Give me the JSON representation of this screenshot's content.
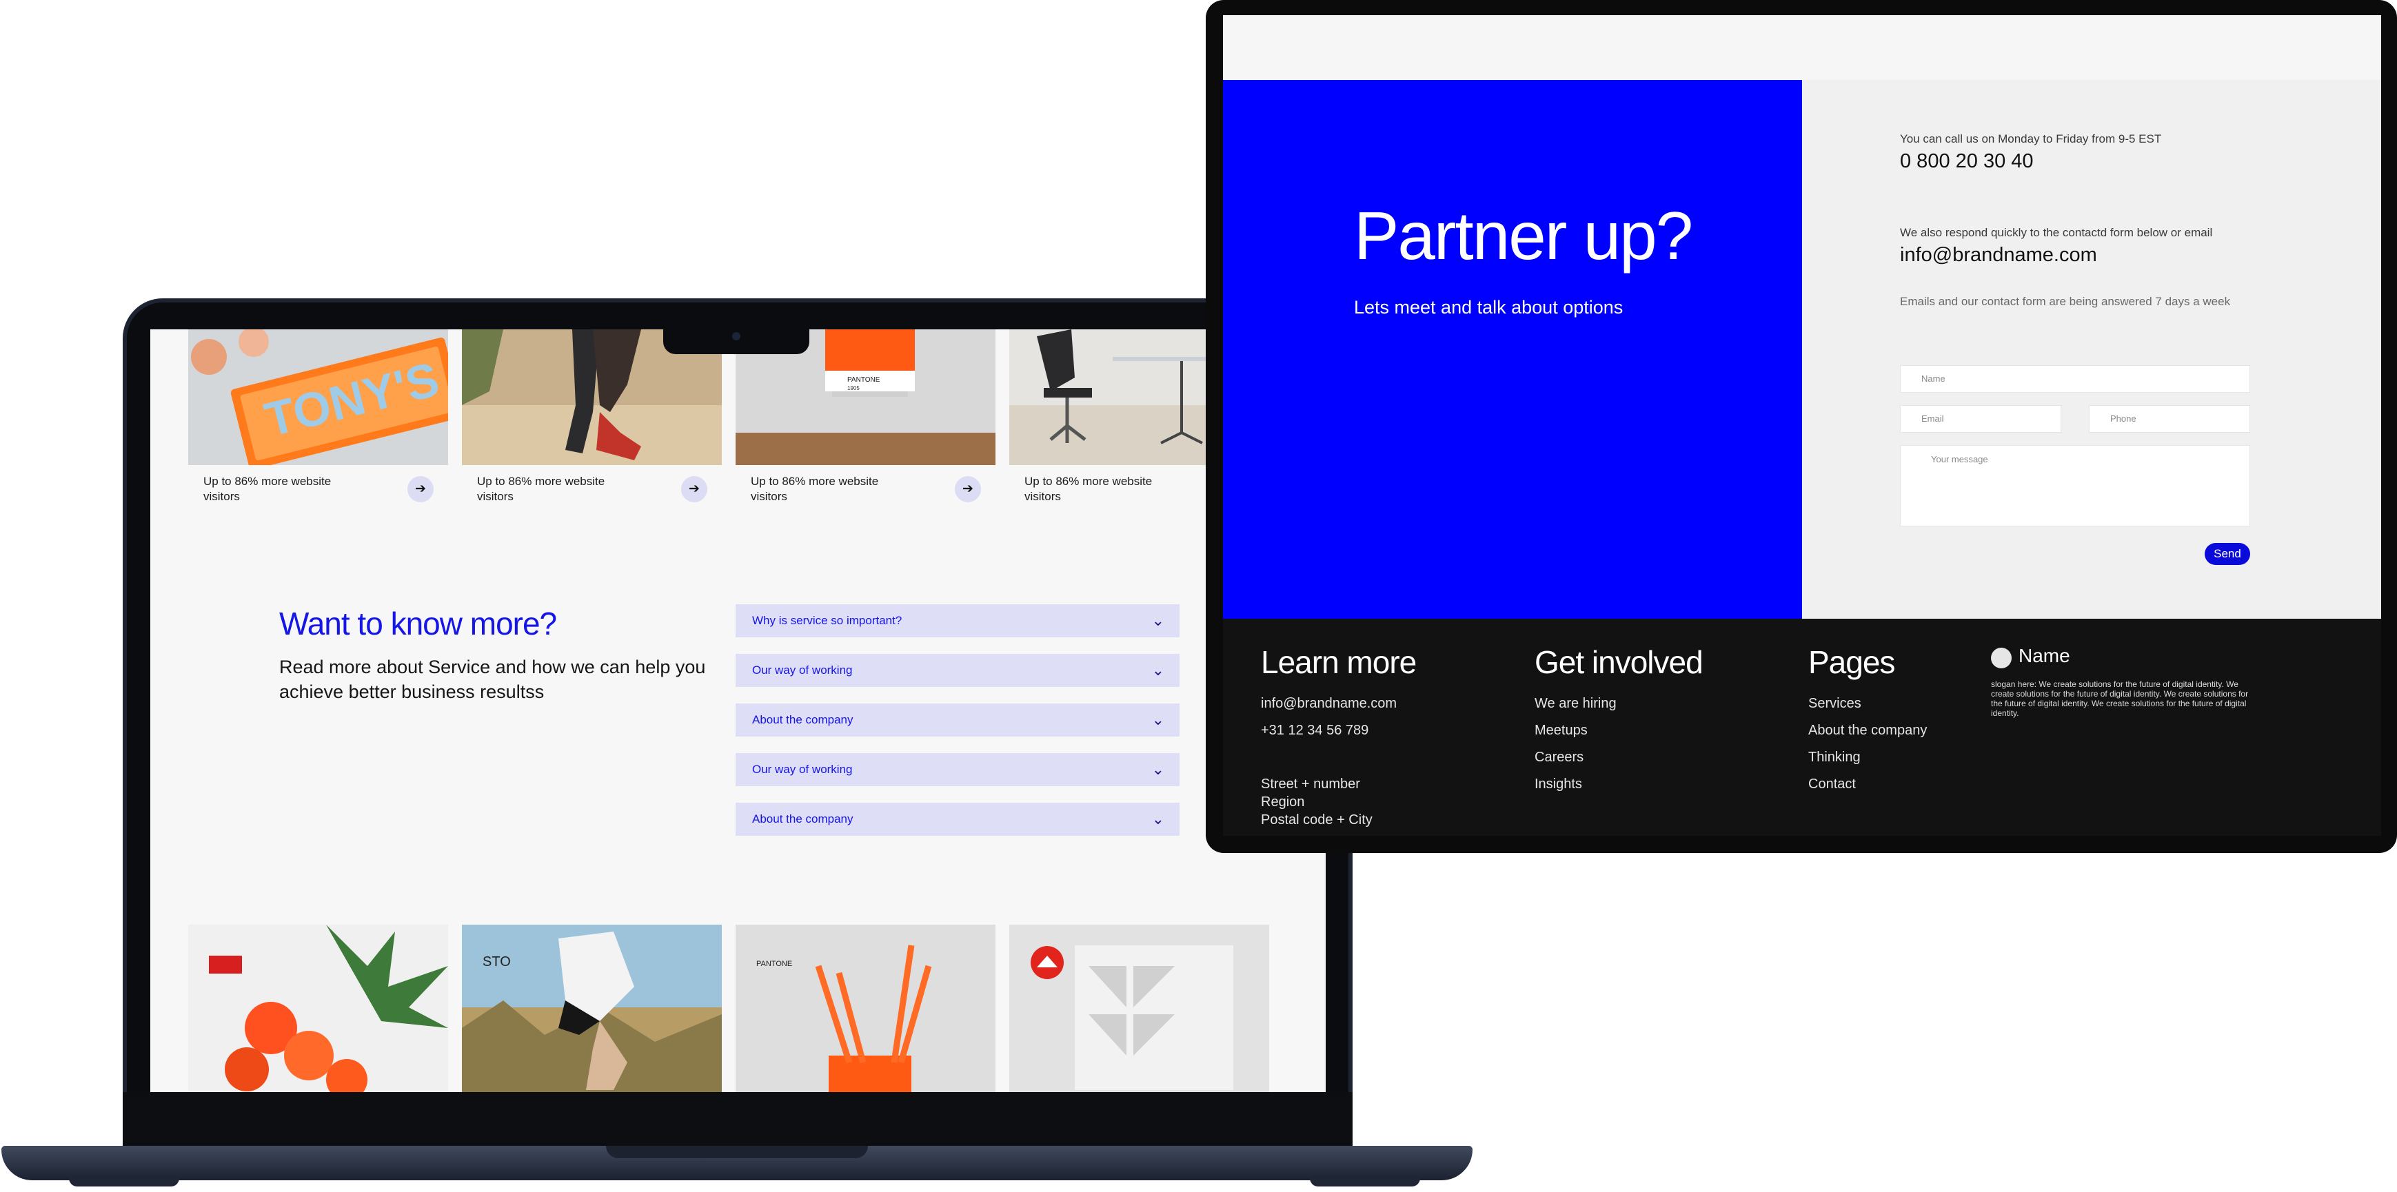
{
  "laptop_page": {
    "top_cards": [
      {
        "caption": "Up to 86% more website visitors",
        "has_arrow": true
      },
      {
        "caption": "Up to 86% more website visitors",
        "has_arrow": true
      },
      {
        "caption": "Up to 86% more website visitors",
        "has_arrow": true
      },
      {
        "caption": "Up to 86% more website visitors",
        "has_arrow": false
      }
    ],
    "tile_texts": {
      "tonys": "TONY'S",
      "pantone": "PANTONE",
      "pantone_code": "1905",
      "sto": "STO"
    },
    "faq": {
      "heading": "Want to know more?",
      "subtext": "Read more about Service and how we can help you achieve better business resultss",
      "items": [
        {
          "label": "Why is service so important?"
        },
        {
          "label": "Our way of working"
        },
        {
          "label": "About the company"
        },
        {
          "label": "Our way of working"
        },
        {
          "label": "About the company"
        }
      ]
    }
  },
  "contact_page": {
    "hero": {
      "title": "Partner up?",
      "subtitle": "Lets meet and talk about options"
    },
    "contact": {
      "call_hint": "You can call us on Monday to Friday from 9-5 EST",
      "phone": "0 800 20 30 40",
      "email_hint": "We also respond quickly to the contactd form below or email",
      "email": "info@brandname.com",
      "response_note": "Emails and our contact form are being answered 7 days a week"
    },
    "form": {
      "name_placeholder": "Name",
      "email_placeholder": "Email",
      "phone_placeholder": "Phone",
      "message_placeholder": "Your message",
      "send_label": "Send"
    },
    "footer": {
      "learn_more": {
        "heading": "Learn more",
        "email": "info@brandname.com",
        "phone": "+31 12 34 56 789",
        "address": [
          "Street + number",
          "Region",
          "Postal code + City"
        ]
      },
      "get_involved": {
        "heading": "Get involved",
        "links": [
          "We are hiring",
          "Meetups",
          "Careers",
          "Insights"
        ]
      },
      "pages": {
        "heading": "Pages",
        "links": [
          "Services",
          "About the company",
          "Thinking",
          "Contact"
        ]
      },
      "brand": {
        "name": "Name",
        "slogan": "slogan here: We create solutions for the future of digital identity. We create solutions for the future of digital identity. We create solutions for the future of digital identity. We create solutions for the future of digital identity."
      }
    }
  },
  "colors": {
    "accent_blue": "#0000ff",
    "faq_bg": "#dedef7",
    "footer_bg": "#121212",
    "tile_orange": "#ff5a14"
  },
  "icons": [
    "arrow-right-icon",
    "chevron-down-icon",
    "camera-icon"
  ]
}
